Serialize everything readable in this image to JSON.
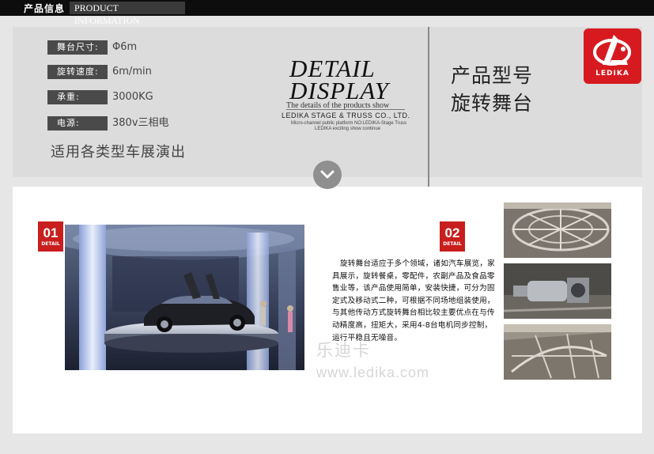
{
  "header": {
    "title_cn": "产品信息",
    "title_en": "PRODUCT INFORMATION"
  },
  "specs": [
    {
      "label": "舞台尺寸:",
      "value": "Φ6m"
    },
    {
      "label": "旋转速度:",
      "value": "6m/min"
    },
    {
      "label": "承重:",
      "value": "3000KG"
    },
    {
      "label": "电源:",
      "value": "380v三相电"
    }
  ],
  "apply_text": "适用各类型车展演出",
  "detail": {
    "line1": "DETAIL",
    "line2": "DISPLAY",
    "subtitle": "The details of the products show",
    "company": "LEDIKA STAGE & TRUSS CO., LTD.",
    "small1": "Micro-channel public platform NO:LEDIKA-Stage Truss",
    "small2": "LEDIKA exciting show continue"
  },
  "model": {
    "label": "产品型号",
    "name": "旋转舞台"
  },
  "logo": {
    "text": "LEDIKA",
    "color": "#d71a20"
  },
  "badges": [
    {
      "num": "01",
      "label": "DETAIL"
    },
    {
      "num": "02",
      "label": "DETAIL"
    }
  ],
  "description": "旋转舞台适应于多个领域，诸如汽车展览，家具展示，旋转餐桌，零配件，农副产品及食品零售业等，该产品使用简单，安装快捷，可分为固定式及移动式二种，可根据不同场地组装使用，与其他传动方式旋转舞台相比较主要优点在与传动精度高，扭矩大，采用4-8台电机同步控制，运行平稳且无噪音。",
  "watermark": {
    "cn": "乐迪卡",
    "url": "www.ledika.com"
  },
  "accent_color": "#c81e1e"
}
